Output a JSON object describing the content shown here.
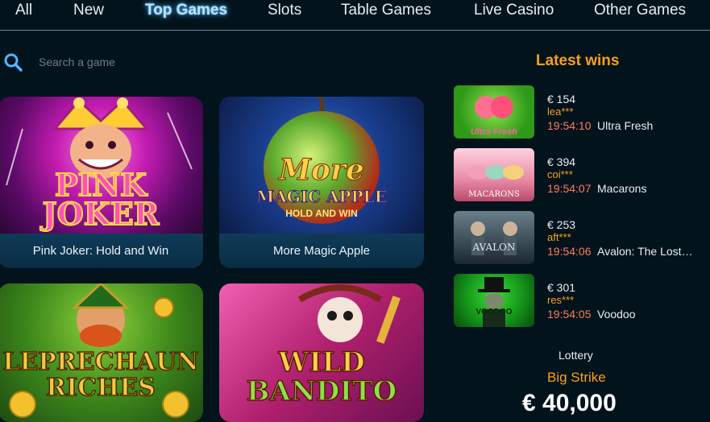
{
  "nav": {
    "tabs": [
      "All",
      "New",
      "Top Games",
      "Slots",
      "Table Games",
      "Live Casino",
      "Other Games"
    ],
    "active": "Top Games"
  },
  "search": {
    "placeholder": "Search a game",
    "icon": "search-icon"
  },
  "games": [
    {
      "title": "Pink Joker: Hold and Win",
      "logo": [
        "PINK",
        "JOKER"
      ]
    },
    {
      "title": "More Magic Apple",
      "logo": [
        "More",
        "MAGIC APPLE",
        "HOLD AND WIN"
      ]
    },
    {
      "title": "",
      "logo": [
        "LEPRECHAUN",
        "RICHES"
      ]
    },
    {
      "title": "",
      "logo": [
        "WILD",
        "BANDITO"
      ]
    }
  ],
  "latest_wins": {
    "title": "Latest wins",
    "items": [
      {
        "amount": "€ 154",
        "user": "lea***",
        "time": "19:54:10",
        "game": "Ultra Fresh",
        "thumb_text": "Ultra Fresh"
      },
      {
        "amount": "€ 394",
        "user": "coi***",
        "time": "19:54:07",
        "game": "Macarons",
        "thumb_text": "MACARONS"
      },
      {
        "amount": "€ 253",
        "user": "aft***",
        "time": "19:54:06",
        "game": "Avalon: The Lost…",
        "thumb_text": "AVALON"
      },
      {
        "amount": "€ 301",
        "user": "res***",
        "time": "19:54:05",
        "game": "Voodoo",
        "thumb_text": "VOODOO"
      }
    ]
  },
  "lottery": {
    "label": "Lottery",
    "name": "Big Strike",
    "amount": "€ 40,000"
  },
  "colors": {
    "accent": "#ff9f1a",
    "time": "#ff7a5a",
    "background": "#02131c",
    "active_tab": "#b7e2ff"
  }
}
